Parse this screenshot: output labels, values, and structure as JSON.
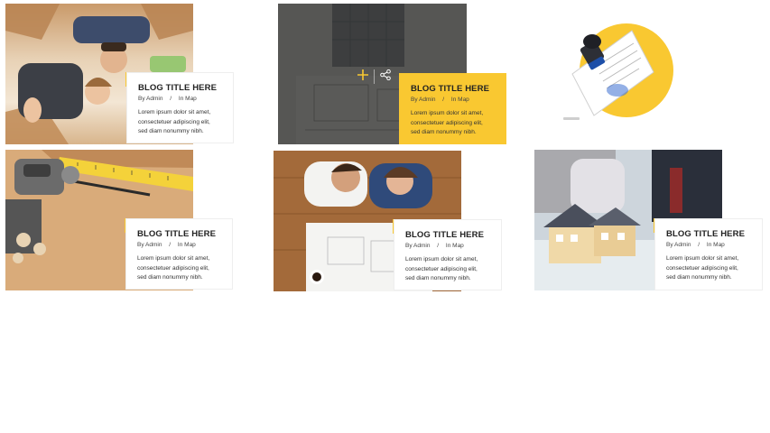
{
  "posts": [
    {
      "title": "BLOG TITLE HERE",
      "by_prefix": "By",
      "author": "Admin",
      "separator": "/",
      "in_prefix": "In",
      "category": "Map",
      "excerpt_lines": [
        "Lorem ipsum dolor sit amet,",
        "consectetuer adipiscing elit,",
        "sed diam nonummy nibh."
      ],
      "image": "boxes-moving-people-photo"
    },
    {
      "title": "BLOG TITLE HERE",
      "by_prefix": "By",
      "author": "Admin",
      "separator": "/",
      "in_prefix": "In",
      "category": "Map",
      "excerpt_lines": [
        "Lorem ipsum dolor sit amet,",
        "consectetuer adipiscing elit,",
        "sed diam nonummy nibh."
      ],
      "image": "blueprint-architect-photo",
      "hover_icons": [
        "plus-icon",
        "share-icon"
      ]
    },
    {
      "title": "",
      "image": "stamp-document-illustration"
    },
    {
      "title": "BLOG TITLE HERE",
      "by_prefix": "By",
      "author": "Admin",
      "separator": "/",
      "in_prefix": "In",
      "category": "Map",
      "excerpt_lines": [
        "Lorem ipsum dolor sit amet,",
        "consectetuer adipiscing elit,",
        "sed diam nonummy nibh."
      ],
      "image": "woodworking-tools-photo"
    },
    {
      "title": "BLOG TITLE HERE",
      "by_prefix": "By",
      "author": "Admin",
      "separator": "/",
      "in_prefix": "In",
      "category": "Map",
      "excerpt_lines": [
        "Lorem ipsum dolor sit amet,",
        "consectetuer adipiscing elit,",
        "sed diam nonummy nibh."
      ],
      "image": "couple-floor-plan-photo"
    },
    {
      "title": "BLOG TITLE HERE",
      "by_prefix": "By",
      "author": "Admin",
      "separator": "/",
      "in_prefix": "In",
      "category": "Map",
      "excerpt_lines": [
        "Lorem ipsum dolor sit amet,",
        "consectetuer adipiscing elit,",
        "sed diam nonummy nibh."
      ],
      "image": "house-model-meeting-photo"
    }
  ],
  "colors": {
    "accent": "#f9c831",
    "text": "#222222",
    "card_bg": "#ffffff"
  }
}
